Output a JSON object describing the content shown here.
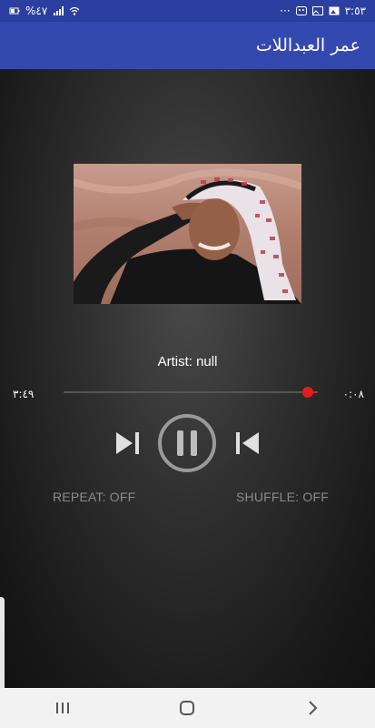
{
  "status_bar": {
    "time": "٣:٥٣",
    "battery": "%٤٧",
    "icons": [
      "more-dots-icon",
      "game-face-icon",
      "gallery-icon",
      "image-icon",
      "battery-icon",
      "signal-icon",
      "wifi-icon"
    ]
  },
  "app_bar": {
    "title": "عمر العبداللات",
    "color": "#3449b0"
  },
  "player": {
    "artist_label": "Artist: null",
    "elapsed": "٠:٠٨",
    "duration": "٣:٤٩",
    "progress_fraction": 0.04,
    "accent_color": "#e01e1e",
    "repeat_label": "REPEAT: OFF",
    "shuffle_label": "SHUFFLE: OFF",
    "controls": [
      "skip-next-icon",
      "pause-icon",
      "skip-previous-icon"
    ]
  },
  "nav_bar": {
    "buttons": [
      "recent-apps-icon",
      "home-icon",
      "back-icon"
    ]
  }
}
